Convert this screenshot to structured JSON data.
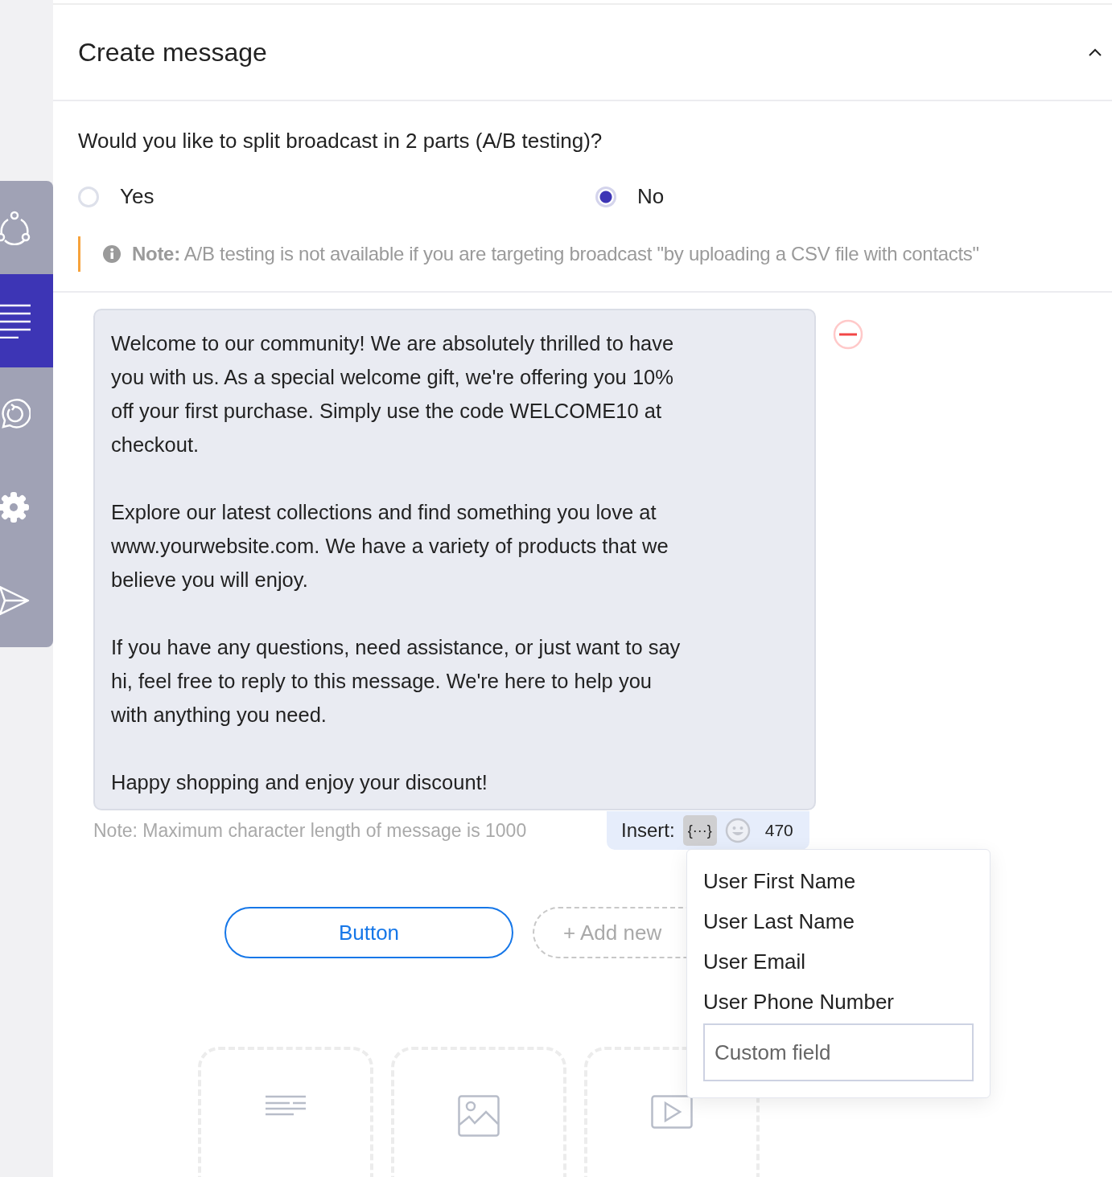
{
  "sidebar": {
    "items": [
      {
        "kind": "share",
        "selected": false
      },
      {
        "kind": "lines",
        "selected": true
      },
      {
        "kind": "chat",
        "selected": false
      },
      {
        "kind": "gear",
        "selected": false
      },
      {
        "kind": "send",
        "selected": false
      }
    ]
  },
  "section": {
    "title": "Create message",
    "expanded": true
  },
  "ab_question": "Would you like to split broadcast in 2 parts (A/B testing)?",
  "ab_options": [
    {
      "label": "Yes",
      "selected": false
    },
    {
      "label": "No",
      "selected": true
    }
  ],
  "ab_note": "**Note:** A/B testing is not available if you are targeting broadcast \"by uploading a CSV file with contacts\"",
  "message": {
    "paragraphs": [
      "Welcome to our community! We are absolutely thrilled to have you with us. As a special welcome gift, we're offering you 10% off your first purchase. Simply use the code WELCOME10 at checkout.",
      "Explore our latest collections and find something you love at www.yourwebsite.com. We have a variety of products that we believe you will enjoy.",
      "If you have any questions, need assistance, or just want to say hi, feel free to reply to this message. We're here to help you with anything you need.",
      "Happy shopping and enjoy your discount!"
    ],
    "length_note": "Note: Maximum character length of message is 1000",
    "insert_label": "Insert:",
    "variable_button": "{···}",
    "char_count": "470"
  },
  "variables_menu": {
    "items": [
      "User First Name",
      "User Last Name",
      "User Email",
      "User Phone Number"
    ],
    "custom_placeholder": "Custom field"
  },
  "buttons": {
    "button_label": "Button",
    "add_new": "+ Add new"
  },
  "content_tiles": [
    {
      "kind": "text"
    },
    {
      "kind": "image"
    },
    {
      "kind": "video"
    }
  ]
}
